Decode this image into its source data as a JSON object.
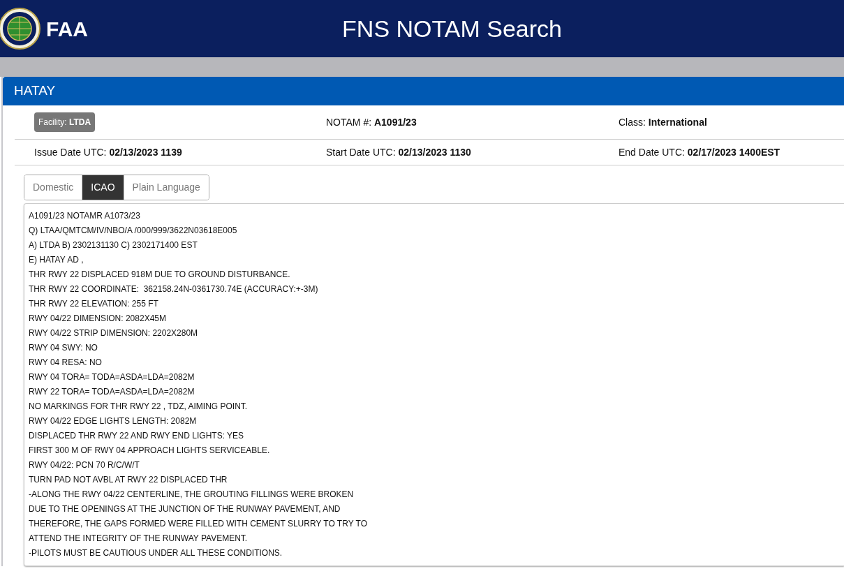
{
  "header": {
    "logo_text": "FAA",
    "title": "FNS NOTAM Search"
  },
  "panel": {
    "title": "HATAY"
  },
  "fields_row_1": [
    {
      "kind": "badge",
      "label": "Facility:",
      "value": "LTDA"
    },
    {
      "kind": "plain",
      "label": "NOTAM #:",
      "value": "A1091/23"
    },
    {
      "kind": "plain",
      "label": "Class:",
      "value": "International"
    }
  ],
  "fields_row_2": [
    {
      "kind": "plain",
      "label": "Issue Date UTC:",
      "value": "02/13/2023 1139"
    },
    {
      "kind": "plain",
      "label": "Start Date UTC:",
      "value": "02/13/2023 1130"
    },
    {
      "kind": "plain",
      "label": "End Date UTC:",
      "value": "02/17/2023 1400EST"
    }
  ],
  "tabs": [
    {
      "label": "Domestic",
      "selected": false
    },
    {
      "label": "ICAO",
      "selected": true
    },
    {
      "label": "Plain Language",
      "selected": false
    }
  ],
  "notam_lines": [
    "A1091/23 NOTAMR A1073/23",
    "Q) LTAA/QMTCM/IV/NBO/A /000/999/3622N03618E005",
    "A) LTDA B) 2302131130 C) 2302171400 EST",
    "E) HATAY AD ,",
    "THR RWY 22 DISPLACED 918M DUE TO GROUND DISTURBANCE.",
    "THR RWY 22 COORDINATE:  362158.24N-0361730.74E (ACCURACY:+-3M)",
    "THR RWY 22 ELEVATION: 255 FT",
    "RWY 04/22 DIMENSION: 2082X45M",
    "RWY 04/22 STRIP DIMENSION: 2202X280M",
    "RWY 04 SWY: NO",
    "RWY 04 RESA: NO",
    "RWY 04 TORA= TODA=ASDA=LDA=2082M",
    "RWY 22 TORA= TODA=ASDA=LDA=2082M",
    "NO MARKINGS FOR THR RWY 22 , TDZ, AIMING POINT.",
    "RWY 04/22 EDGE LIGHTS LENGTH: 2082M",
    "DISPLACED THR RWY 22 AND RWY END LIGHTS: YES",
    "FIRST 300 M OF RWY 04 APPROACH LIGHTS SERVICEABLE.",
    "RWY 04/22: PCN 70 R/C/W/T",
    "TURN PAD NOT AVBL AT RWY 22 DISPLACED THR",
    "-ALONG THE RWY 04/22 CENTERLINE, THE GROUTING FILLINGS WERE BROKEN",
    "DUE TO THE OPENINGS AT THE JUNCTION OF THE RUNWAY PAVEMENT, AND",
    "THEREFORE, THE GAPS FORMED WERE FILLED WITH CEMENT SLURRY TO TRY TO",
    "ATTEND THE INTEGRITY OF THE RUNWAY PAVEMENT.",
    "-PILOTS MUST BE CAUTIOUS UNDER ALL THESE CONDITIONS."
  ]
}
